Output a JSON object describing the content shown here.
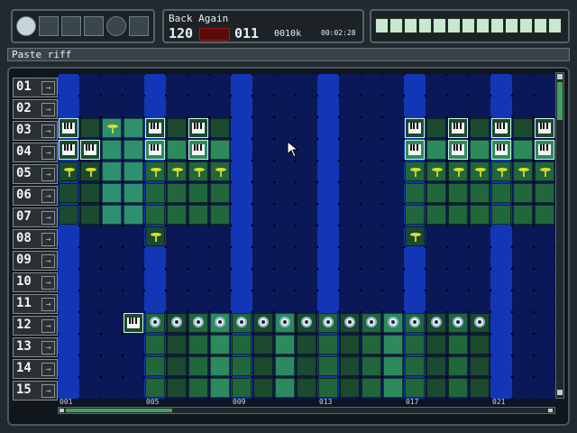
{
  "song": {
    "title": "Back Again",
    "tempo": "120",
    "position": "011",
    "memory": "0010k",
    "time": "00:02:28"
  },
  "status_text": "Paste riff",
  "left_icons": [
    "pointer-icon",
    "mixer-icon",
    "download-icon",
    "disk-icon",
    "reel-icon",
    "grid-icon"
  ],
  "toolbar": [
    "paste-icon",
    "trash-icon",
    "arrow-right-icon",
    "stop-icon",
    "record-icon",
    "loop-icon",
    "book-icon",
    "skip-back-icon",
    "skip-forward-icon",
    "save-icon",
    "settings-icon",
    "play-icon",
    "help-icon"
  ],
  "rows": [
    "01",
    "02",
    "03",
    "04",
    "05",
    "06",
    "07",
    "08",
    "09",
    "10",
    "11",
    "12",
    "13",
    "14",
    "15"
  ],
  "timeline_ticks": [
    "001",
    "005",
    "009",
    "013",
    "017",
    "021"
  ],
  "colors": {
    "accent": "#c8e8d0",
    "grid_dark": "#0b1858",
    "grid_light": "#1236b6"
  }
}
